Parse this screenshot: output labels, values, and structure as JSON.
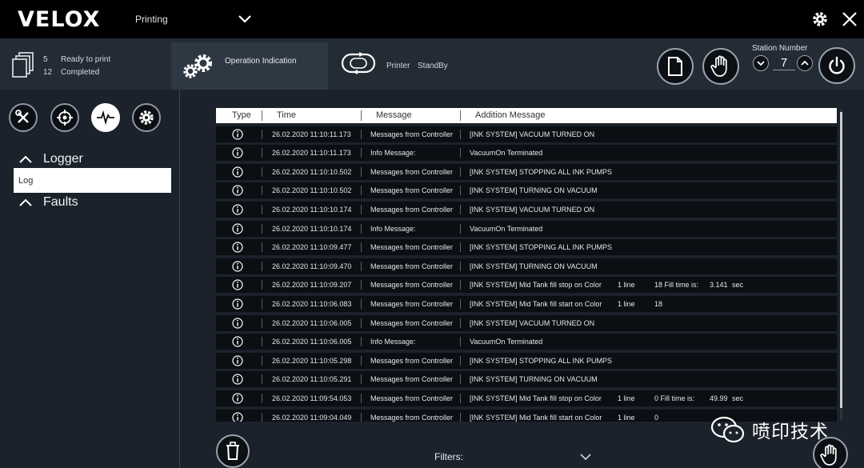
{
  "app": {
    "logo": "VELOX",
    "mode": "Printing"
  },
  "jobs": {
    "ready_count": "5",
    "ready_label": "Ready to print",
    "completed_count": "12",
    "completed_label": "Completed"
  },
  "operation": {
    "label": "Operation Indication"
  },
  "printer": {
    "label": "Printer",
    "state": "StandBy"
  },
  "station": {
    "label": "Station Number",
    "value": "7"
  },
  "sidebar": {
    "logger": "Logger",
    "log": "Log",
    "faults": "Faults"
  },
  "table": {
    "headers": [
      "Type",
      "Time",
      "Message",
      "Addition Message"
    ],
    "rows": [
      {
        "time": "26.02.2020 11:10:11.173",
        "message": "Messages from Controller",
        "addition": "[INK SYSTEM] VACUUM TURNED ON",
        "e1": "",
        "e2": "",
        "e3": "",
        "e4": ""
      },
      {
        "time": "26.02.2020 11:10:11.173",
        "message": "Info Message:",
        "addition": "VacuumOn Terminated",
        "e1": "",
        "e2": "",
        "e3": "",
        "e4": ""
      },
      {
        "time": "26.02.2020 11:10:10.502",
        "message": "Messages from Controller",
        "addition": "[INK SYSTEM] STOPPING ALL INK PUMPS",
        "e1": "",
        "e2": "",
        "e3": "",
        "e4": ""
      },
      {
        "time": "26.02.2020 11:10:10.502",
        "message": "Messages from Controller",
        "addition": "[INK SYSTEM] TURNING ON VACUUM",
        "e1": "",
        "e2": "",
        "e3": "",
        "e4": ""
      },
      {
        "time": "26.02.2020 11:10:10.174",
        "message": "Messages from Controller",
        "addition": "[INK SYSTEM] VACUUM TURNED ON",
        "e1": "",
        "e2": "",
        "e3": "",
        "e4": ""
      },
      {
        "time": "26.02.2020 11:10:10.174",
        "message": "Info Message:",
        "addition": "VacuumOn Terminated",
        "e1": "",
        "e2": "",
        "e3": "",
        "e4": ""
      },
      {
        "time": "26.02.2020 11:10:09.477",
        "message": "Messages from Controller",
        "addition": "[INK SYSTEM] STOPPING ALL INK PUMPS",
        "e1": "",
        "e2": "",
        "e3": "",
        "e4": ""
      },
      {
        "time": "26.02.2020 11:10:09.470",
        "message": "Messages from Controller",
        "addition": "[INK SYSTEM] TURNING ON VACUUM",
        "e1": "",
        "e2": "",
        "e3": "",
        "e4": ""
      },
      {
        "time": "26.02.2020 11:10:09.207",
        "message": "Messages from Controller",
        "addition": "[INK SYSTEM] Mid Tank fill stop on Color",
        "e1": "1 line",
        "e2": "18 Fill time is:",
        "e3": "3.141",
        "e4": "sec"
      },
      {
        "time": "26.02.2020 11:10:06.083",
        "message": "Messages from Controller",
        "addition": "[INK SYSTEM] Mid Tank fill start on Color",
        "e1": "1 line",
        "e2": "18",
        "e3": "",
        "e4": ""
      },
      {
        "time": "26.02.2020 11:10:06.005",
        "message": "Messages from Controller",
        "addition": "[INK SYSTEM] VACUUM TURNED ON",
        "e1": "",
        "e2": "",
        "e3": "",
        "e4": ""
      },
      {
        "time": "26.02.2020 11:10:06.005",
        "message": "Info Message:",
        "addition": "VacuumOn Terminated",
        "e1": "",
        "e2": "",
        "e3": "",
        "e4": ""
      },
      {
        "time": "26.02.2020 11:10:05.298",
        "message": "Messages from Controller",
        "addition": "[INK SYSTEM] STOPPING ALL INK PUMPS",
        "e1": "",
        "e2": "",
        "e3": "",
        "e4": ""
      },
      {
        "time": "26.02.2020 11:10:05.291",
        "message": "Messages from Controller",
        "addition": "[INK SYSTEM] TURNING ON VACUUM",
        "e1": "",
        "e2": "",
        "e3": "",
        "e4": ""
      },
      {
        "time": "26.02.2020 11:09:54.053",
        "message": "Messages from Controller",
        "addition": "[INK SYSTEM] Mid Tank fill stop on Color",
        "e1": "1 line",
        "e2": "0 Fill time is:",
        "e3": "49.99",
        "e4": "sec"
      },
      {
        "time": "26.02.2020 11:09:04.049",
        "message": "Messages from Controller",
        "addition": "[INK SYSTEM] Mid Tank fill start on Color",
        "e1": "1 line",
        "e2": "0",
        "e3": "",
        "e4": ""
      }
    ]
  },
  "footer": {
    "filters_label": "Filters:"
  },
  "watermark": {
    "text": "喷印技术"
  }
}
